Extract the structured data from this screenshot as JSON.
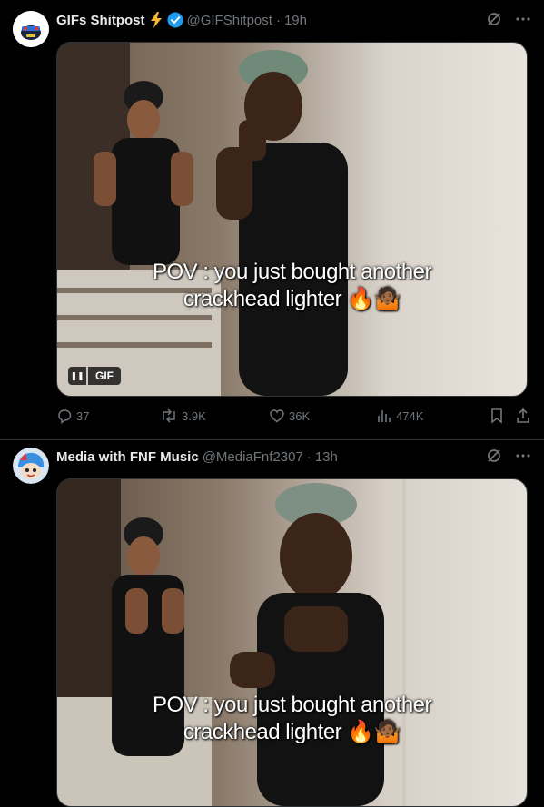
{
  "posts": [
    {
      "name": "GIFs Shitpost",
      "handle": "@GIFShitpost",
      "time": "19h",
      "caption_line1": "POV : you just bought another",
      "caption_line2": "crackhead lighter",
      "caption_emoji": "🔥🤷🏾",
      "gif_label": "GIF",
      "replies": "37",
      "reposts": "3.9K",
      "likes": "36K",
      "views": "474K"
    },
    {
      "name": "Media with FNF Music",
      "handle": "@MediaFnf2307",
      "time": "13h",
      "caption_line1": "POV : you just bought another",
      "caption_line2": "crackhead lighter",
      "caption_emoji": "🔥🤷🏾"
    }
  ],
  "colors": {
    "background": "#000000",
    "text": "#e7e9ea",
    "muted": "#71767b",
    "verified": "#1d9bf0",
    "bolt": "#f7b733"
  },
  "icons": [
    "bolt-icon",
    "verified-badge-icon",
    "grok-icon",
    "more-icon",
    "reply-icon",
    "repost-icon",
    "like-icon",
    "views-icon",
    "bookmark-icon",
    "share-icon",
    "pause-icon"
  ]
}
